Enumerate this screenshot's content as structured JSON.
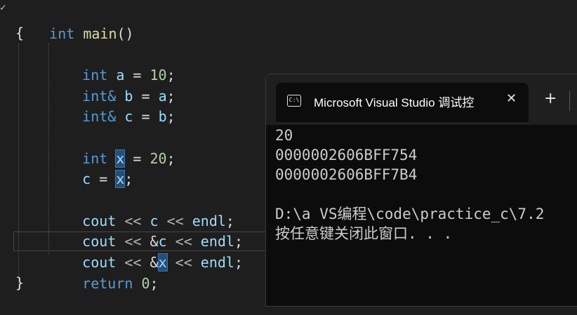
{
  "editor": {
    "fold_glyph": "✓",
    "header": {
      "kw": "int",
      "fn": "main",
      "paren": "()"
    },
    "open_brace": "{",
    "close_brace": "}",
    "l1": {
      "kw": "int",
      "name": "a",
      "eq": " = ",
      "val": "10",
      "semi": ";"
    },
    "l2": {
      "kw": "int&",
      "name": "b",
      "eq": " = ",
      "rhs": "a",
      "semi": ";"
    },
    "l3": {
      "kw": "int&",
      "name": "c",
      "eq": " = ",
      "rhs": "b",
      "semi": ";"
    },
    "l4": {
      "kw": "int",
      "name": "x",
      "eq": " = ",
      "val": "20",
      "semi": ";"
    },
    "l5": {
      "name": "c",
      "eq": " = ",
      "rhs": "x",
      "semi": ";"
    },
    "l6": {
      "cout": "cout",
      "op1": " << ",
      "v": "c",
      "op2": " << ",
      "endl": "endl",
      "semi": ";"
    },
    "l7": {
      "cout": "cout",
      "op1": " << ",
      "amp": "&",
      "v": "c",
      "op2": " << ",
      "endl": "endl",
      "semi": ";"
    },
    "l8": {
      "cout": "cout",
      "op1": " << ",
      "amp": "&",
      "v": "x",
      "op2": " << ",
      "endl": "endl",
      "semi": ";"
    },
    "l9": {
      "kw": "return",
      "val": "0",
      "semi": ";"
    }
  },
  "terminal": {
    "tab_icon_text": "C:\\",
    "tab_title": "Microsoft Visual Studio 调试控",
    "close_glyph": "✕",
    "new_tab_glyph": "+",
    "output": [
      "20",
      "0000002606BFF754",
      "0000002606BFF7B4",
      "",
      "D:\\a VS编程\\code\\practice_c\\7.2",
      "按任意键关闭此窗口. . ."
    ]
  }
}
